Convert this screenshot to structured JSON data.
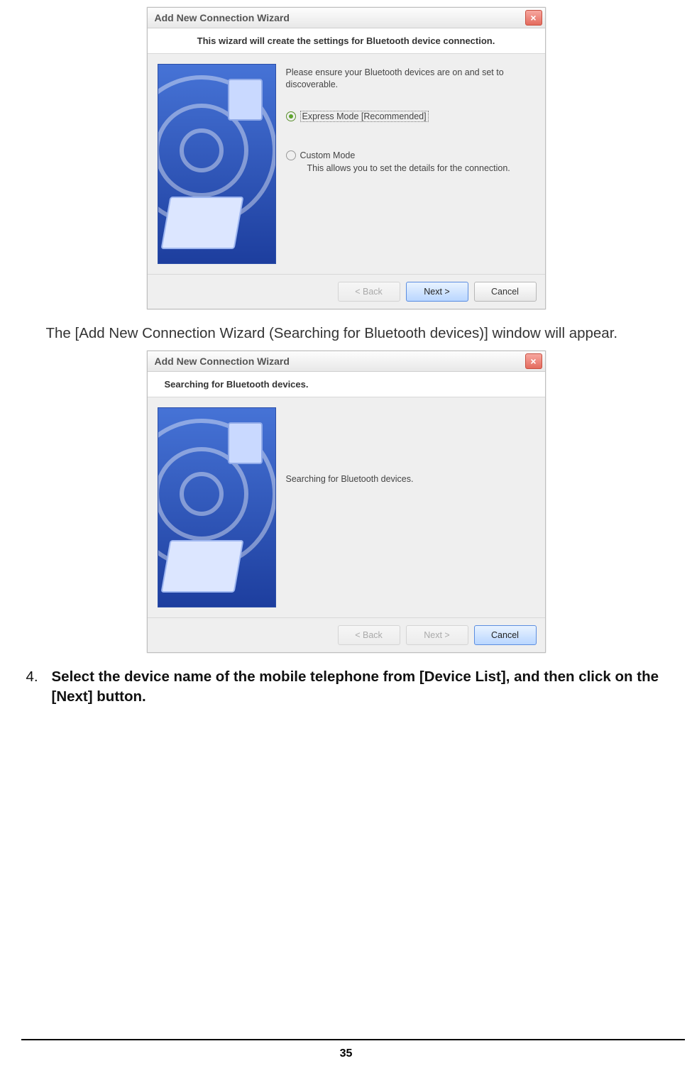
{
  "dialog1": {
    "title": "Add New Connection Wizard",
    "subtitle": "This wizard will create the settings for Bluetooth device connection.",
    "instruction": "Please ensure your Bluetooth devices are on and set to discoverable.",
    "option_express": "Express Mode [Recommended]",
    "option_custom": "Custom Mode",
    "option_custom_desc": "This allows you to set the details for the connection.",
    "btn_back": "< Back",
    "btn_next": "Next >",
    "btn_cancel": "Cancel"
  },
  "caption1": "The [Add New Connection Wizard (Searching for Bluetooth devices)] window will appear.",
  "dialog2": {
    "title": "Add New Connection Wizard",
    "subtitle": "Searching for Bluetooth devices.",
    "message": "Searching for Bluetooth devices.",
    "btn_back": "< Back",
    "btn_next": "Next >",
    "btn_cancel": "Cancel"
  },
  "step4": {
    "num": "4.",
    "text": "Select the device name of the mobile telephone from [Device List], and then click on the [Next] button"
  },
  "page_number": "35"
}
